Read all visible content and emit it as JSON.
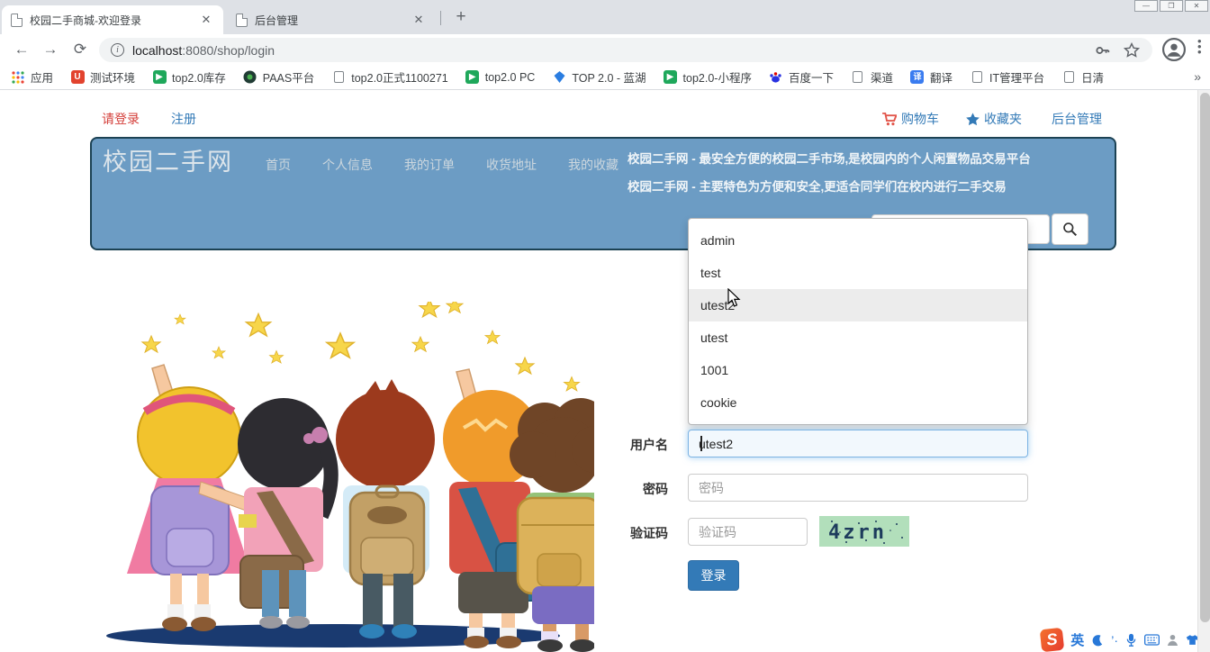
{
  "window_controls": {
    "minimize": "—",
    "restore": "❐",
    "close": "✕"
  },
  "browser": {
    "tabs": [
      {
        "title": "校园二手商城-欢迎登录",
        "close": "✕"
      },
      {
        "title": "后台管理",
        "close": "✕"
      }
    ],
    "new_tab": "+",
    "url_host": "localhost",
    "url_path": ":8080/shop/login",
    "bookmarks": [
      {
        "label": "应用"
      },
      {
        "label": "测试环境"
      },
      {
        "label": "top2.0库存"
      },
      {
        "label": "PAAS平台"
      },
      {
        "label": "top2.0正式1100271"
      },
      {
        "label": "top2.0 PC"
      },
      {
        "label": "TOP 2.0 - 蓝湖"
      },
      {
        "label": "top2.0-小程序"
      },
      {
        "label": "百度一下"
      },
      {
        "label": "渠道"
      },
      {
        "label": "翻译"
      },
      {
        "label": "IT管理平台"
      },
      {
        "label": "日清"
      }
    ],
    "bookmarks_overflow": "»"
  },
  "page": {
    "header": {
      "login": "请登录",
      "register": "注册",
      "cart": "购物车",
      "favorites": "收藏夹",
      "admin": "后台管理"
    },
    "navbar": {
      "brand": "校园二手网",
      "items": [
        {
          "label": "首页"
        },
        {
          "label": "个人信息"
        },
        {
          "label": "我的订单"
        },
        {
          "label": "收货地址"
        },
        {
          "label": "我的收藏"
        }
      ],
      "desc_line1": "校园二手网 - 最安全方便的校园二手市场,是校园内的个人闲置物品交易平台",
      "desc_line2": "校园二手网 - 主要特色为方便和安全,更适合同学们在校内进行二手交易"
    },
    "autocomplete": {
      "items": [
        "admin",
        "test",
        "utest2",
        "utest",
        "1001",
        "cookie"
      ],
      "highlighted": "utest2"
    },
    "form": {
      "username_label": "用户名",
      "username_value": "utest2",
      "password_label": "密码",
      "password_placeholder": "密码",
      "captcha_label": "验证码",
      "captcha_placeholder": "验证码",
      "captcha_text": "4zrn",
      "login_button": "登录"
    }
  },
  "ime": {
    "lang": "英"
  },
  "colors": {
    "navbar_blue": "#6c9cc4",
    "link_blue": "#337ab7",
    "accent_red": "#d43f3a",
    "captcha_bg": "#b2dfbb",
    "captcha_text": "#1d3b5c",
    "login_button_bg": "#337ab7"
  }
}
